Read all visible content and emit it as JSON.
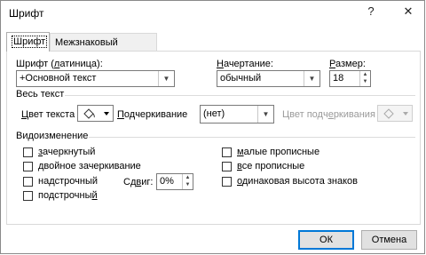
{
  "window": {
    "title": "Шрифт",
    "help_glyph": "?",
    "close_glyph": "✕"
  },
  "tabs": [
    {
      "label": "Шрифт",
      "active": true
    },
    {
      "label": "Межзнаковый интервал",
      "active": false
    }
  ],
  "font": {
    "latin_label": "Шрифт (латиница):",
    "latin_value": "+Основной текст",
    "style_label": "Начертание:",
    "style_value": "обычный",
    "size_label": "Размер:",
    "size_value": "18"
  },
  "all_text": {
    "section_label": "Весь текст",
    "color_label": "Цвет текста",
    "underline_label": "Подчеркивание",
    "underline_value": "(нет)",
    "underline_color_label": "Цвет подчеркивания"
  },
  "effects": {
    "section_label": "Видоизменение",
    "left": [
      {
        "label": "зачеркнутый",
        "checked": false
      },
      {
        "label": "двойное зачеркивание",
        "checked": false
      },
      {
        "label": "надстрочный",
        "checked": false
      },
      {
        "label": "подстрочный",
        "checked": false
      }
    ],
    "offset_label": "Сдвиг:",
    "offset_value": "0%",
    "right": [
      {
        "label": "малые прописные",
        "checked": false
      },
      {
        "label": "все прописные",
        "checked": false
      },
      {
        "label": "одинаковая высота знаков",
        "checked": false
      }
    ]
  },
  "buttons": {
    "ok": "ОК",
    "cancel": "Отмена"
  },
  "colors": {
    "accent": "#0078d7",
    "button_face": "#e1e1e1"
  },
  "icons": {
    "color_picker": "paint-bucket-icon",
    "dropdown": "chevron-down-icon"
  }
}
